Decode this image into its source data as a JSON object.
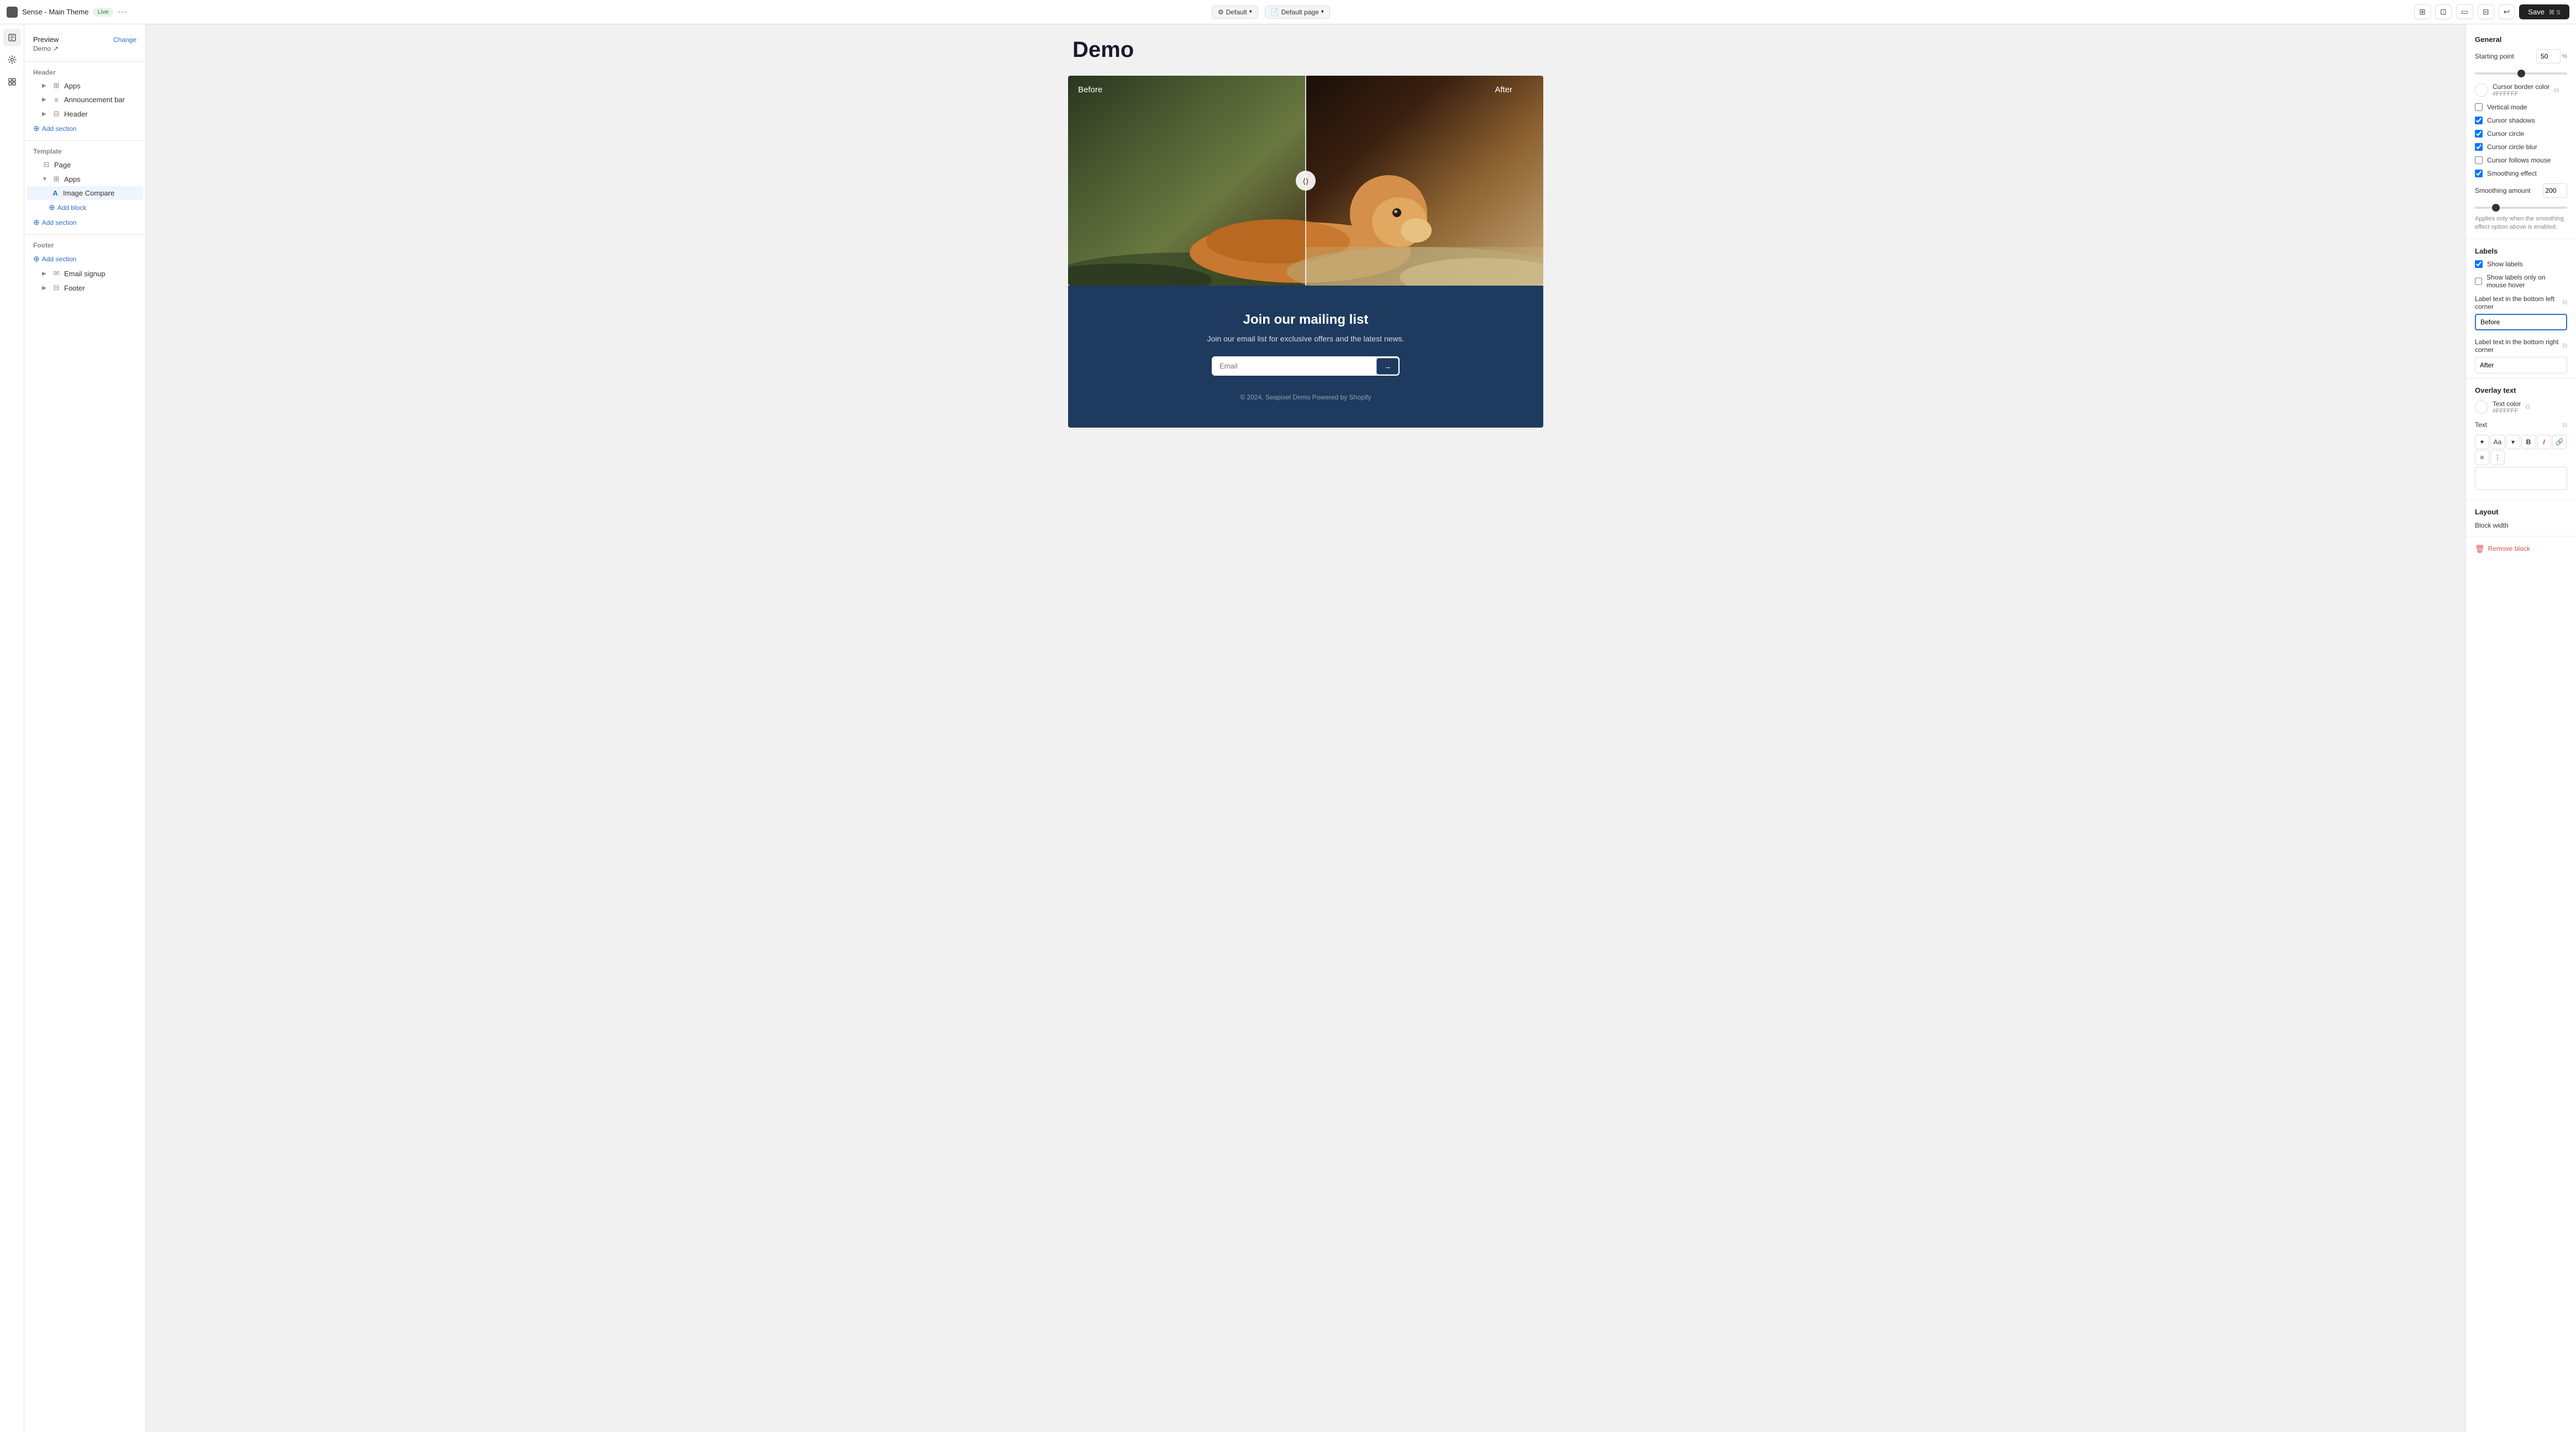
{
  "topbar": {
    "app_name": "Sense - Main Theme",
    "live_label": "Live",
    "dots_label": "···",
    "default_view": "Default",
    "default_page": "Default page",
    "save_label": "Save",
    "save_shortcut": "⌘ S"
  },
  "icon_sidebar": {
    "icons": [
      "pages",
      "settings",
      "apps"
    ]
  },
  "left_panel": {
    "preview_label": "Preview",
    "preview_sub": "Demo",
    "change_label": "Change",
    "section_header": "Header",
    "tree": [
      {
        "id": "apps-header",
        "label": "Apps",
        "indent": 1,
        "arrow": "▶",
        "icon": "⊞"
      },
      {
        "id": "announcement-bar",
        "label": "Announcement bar",
        "indent": 1,
        "arrow": "▶",
        "icon": "≡"
      },
      {
        "id": "header",
        "label": "Header",
        "indent": 1,
        "arrow": "▶",
        "icon": "⊟"
      }
    ],
    "add_section_1": "Add section",
    "section_template": "Template",
    "template_tree": [
      {
        "id": "page",
        "label": "Page",
        "indent": 1,
        "icon": "⊟"
      }
    ],
    "apps_label": "Apps",
    "apps_tree": [
      {
        "id": "image-compare",
        "label": "Image Compare",
        "indent": 2,
        "icon": "A",
        "selected": true
      }
    ],
    "add_block_label": "Add block",
    "add_section_2": "Add section",
    "section_footer": "Footer",
    "footer_add_section": "Add section",
    "footer_tree": [
      {
        "id": "email-signup",
        "label": "Email signup",
        "indent": 1,
        "arrow": "▶",
        "icon": "✉"
      },
      {
        "id": "footer",
        "label": "Footer",
        "indent": 1,
        "arrow": "▶",
        "icon": "⊟"
      }
    ]
  },
  "canvas": {
    "demo_title": "Demo",
    "before_label": "Before",
    "after_label": "After",
    "mailing_title": "Join our mailing list",
    "mailing_sub": "Join our email list for exclusive offers and the latest news.",
    "email_placeholder": "Email",
    "footer_text": "© 2024, Seapixel Demo Powered by Shopify"
  },
  "right_panel": {
    "general_label": "General",
    "starting_point_label": "Starting point",
    "starting_point_value": "50",
    "starting_point_unit": "%",
    "cursor_border_label": "Cursor border color",
    "cursor_border_hex": "#FFFFFF",
    "vertical_mode_label": "Vertical mode",
    "cursor_shadows_label": "Cursor shadows",
    "cursor_circle_label": "Cursor circle",
    "cursor_circle_blur_label": "Cursor circle blur",
    "cursor_follows_mouse_label": "Cursor follows mouse",
    "smoothing_effect_label": "Smoothing effect",
    "smoothing_amount_label": "Smoothing amount",
    "smoothing_amount_value": "200",
    "smoothing_note": "Applies only when the smoothing effect option above is enabled.",
    "labels_section": "Labels",
    "show_labels_label": "Show labels",
    "show_labels_hover_label": "Show labels only on mouse hover",
    "label_bottom_left_label": "Label text in the bottom left corner",
    "label_bottom_left_value": "Before",
    "label_bottom_right_label": "Label text in the bottom right corner",
    "label_bottom_right_value": "After",
    "overlay_text_label": "Overlay text",
    "text_color_label": "Text color",
    "text_color_hex": "#FFFFFF",
    "text_label": "Text",
    "layout_label": "Layout",
    "block_width_label": "Block width",
    "remove_block_label": "Remove block"
  }
}
